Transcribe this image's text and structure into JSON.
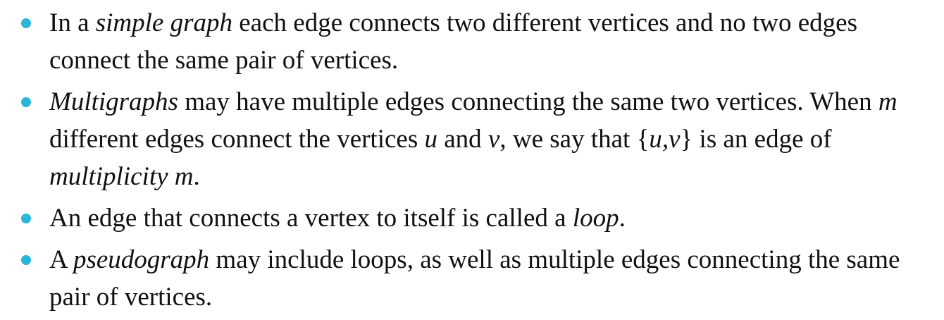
{
  "bullets": [
    {
      "segments": [
        {
          "text": "In a ",
          "italic": false
        },
        {
          "text": "simple graph",
          "italic": true
        },
        {
          "text": " each edge connects two different vertices and no two edges connect the same pair of vertices.",
          "italic": false
        }
      ]
    },
    {
      "segments": [
        {
          "text": "Multigraphs",
          "italic": true
        },
        {
          "text": " may have multiple edges connecting the same two vertices. When ",
          "italic": false
        },
        {
          "text": "m",
          "italic": true
        },
        {
          "text": " different edges connect the vertices ",
          "italic": false
        },
        {
          "text": "u",
          "italic": true
        },
        {
          "text": " and ",
          "italic": false
        },
        {
          "text": "v",
          "italic": true
        },
        {
          "text": ", we say that {",
          "italic": false
        },
        {
          "text": "u,v",
          "italic": true
        },
        {
          "text": "} is an edge of ",
          "italic": false
        },
        {
          "text": "multiplicity m",
          "italic": true
        },
        {
          "text": ".",
          "italic": false
        }
      ]
    },
    {
      "segments": [
        {
          "text": "An edge that connects a vertex to itself is called a ",
          "italic": false
        },
        {
          "text": "loop",
          "italic": true
        },
        {
          "text": ".",
          "italic": false
        }
      ]
    },
    {
      "segments": [
        {
          "text": "A ",
          "italic": false
        },
        {
          "text": "pseudograph",
          "italic": true
        },
        {
          "text": " may include loops, as well as multiple edges connecting the same pair of vertices.",
          "italic": false
        }
      ]
    }
  ],
  "colors": {
    "bullet": "#29b6d8",
    "text": "#111111",
    "background": "#ffffff"
  }
}
